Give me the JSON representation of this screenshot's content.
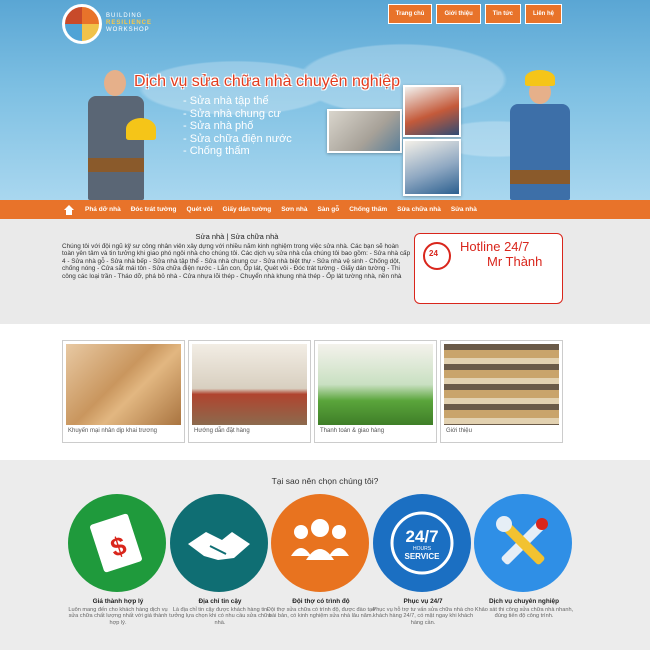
{
  "brand": {
    "logo_line1": "BUILDING",
    "logo_line2": "RESILIENCE",
    "logo_line3": "WORKSHOP"
  },
  "top_nav": [
    "Trang chủ",
    "Giới thiệu",
    "Tin tức",
    "Liên hệ"
  ],
  "hero": {
    "title": "Dịch vụ sửa chữa nhà chuyên nghiệp",
    "services": [
      "Sửa nhà tập thể",
      "Sửa nhà chung cư",
      "Sửa nhà phố",
      "Sửa chữa điện nước",
      "Chống thấm"
    ]
  },
  "main_nav": [
    "Phá dỡ nhà",
    "Đóc trát tường",
    "Quét vôi",
    "Giấy dán tường",
    "Sơn nhà",
    "Sàn gỗ",
    "Chống thấm",
    "Sửa chữa nhà",
    "Sửa nhà"
  ],
  "intro": {
    "heading": "Sửa nhà | Sửa chữa nhà",
    "paragraph": "Chúng tôi với đội ngũ kỹ sư công nhân viên xây dựng với nhiều năm kinh nghiệm trong việc sửa nhà. Các bạn sẽ hoàn toàn yên tâm và tin tưởng khi giao phó ngôi nhà cho chúng tôi. Các dịch vụ sửa nhà của chúng tôi bao gồm: - Sửa nhà cấp 4 - Sửa nhà gỗ - Sửa nhà bếp - Sửa nhà tập thể - Sửa nhà chung cư - Sửa nhà biệt thự - Sửa nhà vệ sinh - Chống dột, chống nóng - Cửa sắt mái tôn - Sửa chữa điện nước - Lắn con, Ốp lát, Quét vôi - Đóc trát tường - Giấy dán tường - Thi công các loại trần - Tháo dỡ, phá bỏ nhà - Cửa nhựa lõi thép - Chuyển nhà khung nhà thép - Ốp lát tường nhà, nền nhà"
  },
  "hotline": {
    "badge": "24",
    "line1": "Hotline 24/7",
    "line2": "Mr Thành"
  },
  "cards": [
    {
      "caption": "Khuyến mại nhân dịp khai trương"
    },
    {
      "caption": "Hướng dẫn đặt hàng"
    },
    {
      "caption": "Thanh toán & giao hàng"
    },
    {
      "caption": "Giới thiệu"
    }
  ],
  "why": {
    "heading": "Tại sao nên chọn chúng tôi?",
    "features": [
      {
        "title": "Giá thành hợp lý",
        "desc": "Luôn mang đến cho khách hàng dịch vụ sửa chữa chất lượng nhất với giá thành hợp lý.",
        "icon": "price-tag-icon",
        "color": "#1f9a3c"
      },
      {
        "title": "Địa chỉ tin cậy",
        "desc": "Là địa chỉ tin cậy được khách hàng tin tưởng lựa chọn khi có nhu cầu sửa chữa nhà.",
        "icon": "handshake-icon",
        "color": "#0f6e73"
      },
      {
        "title": "Đội thợ có trình độ",
        "desc": "Đội thợ sửa chữa có trình độ, được đào tạo bài bản, có kinh nghiệm sửa nhà lâu năm.",
        "icon": "team-icon",
        "color": "#e8731f"
      },
      {
        "title": "Phục vụ 24/7",
        "desc": "Phục vụ hỗ trợ tư vấn sửa chữa nhà cho khách hàng 24/7, có mặt ngay khi khách hàng cần.",
        "icon": "service-24-7-icon",
        "badge_top": "24/7",
        "badge_mid": "HOURS",
        "badge_bottom": "SERVICE",
        "color": "#1b6fc2"
      },
      {
        "title": "Dịch vụ chuyên nghiệp",
        "desc": "Khảo sát thi công sửa chữa nhà nhanh, đúng tiến độ công trình.",
        "icon": "tools-icon",
        "color": "#2f8fe6"
      }
    ]
  }
}
